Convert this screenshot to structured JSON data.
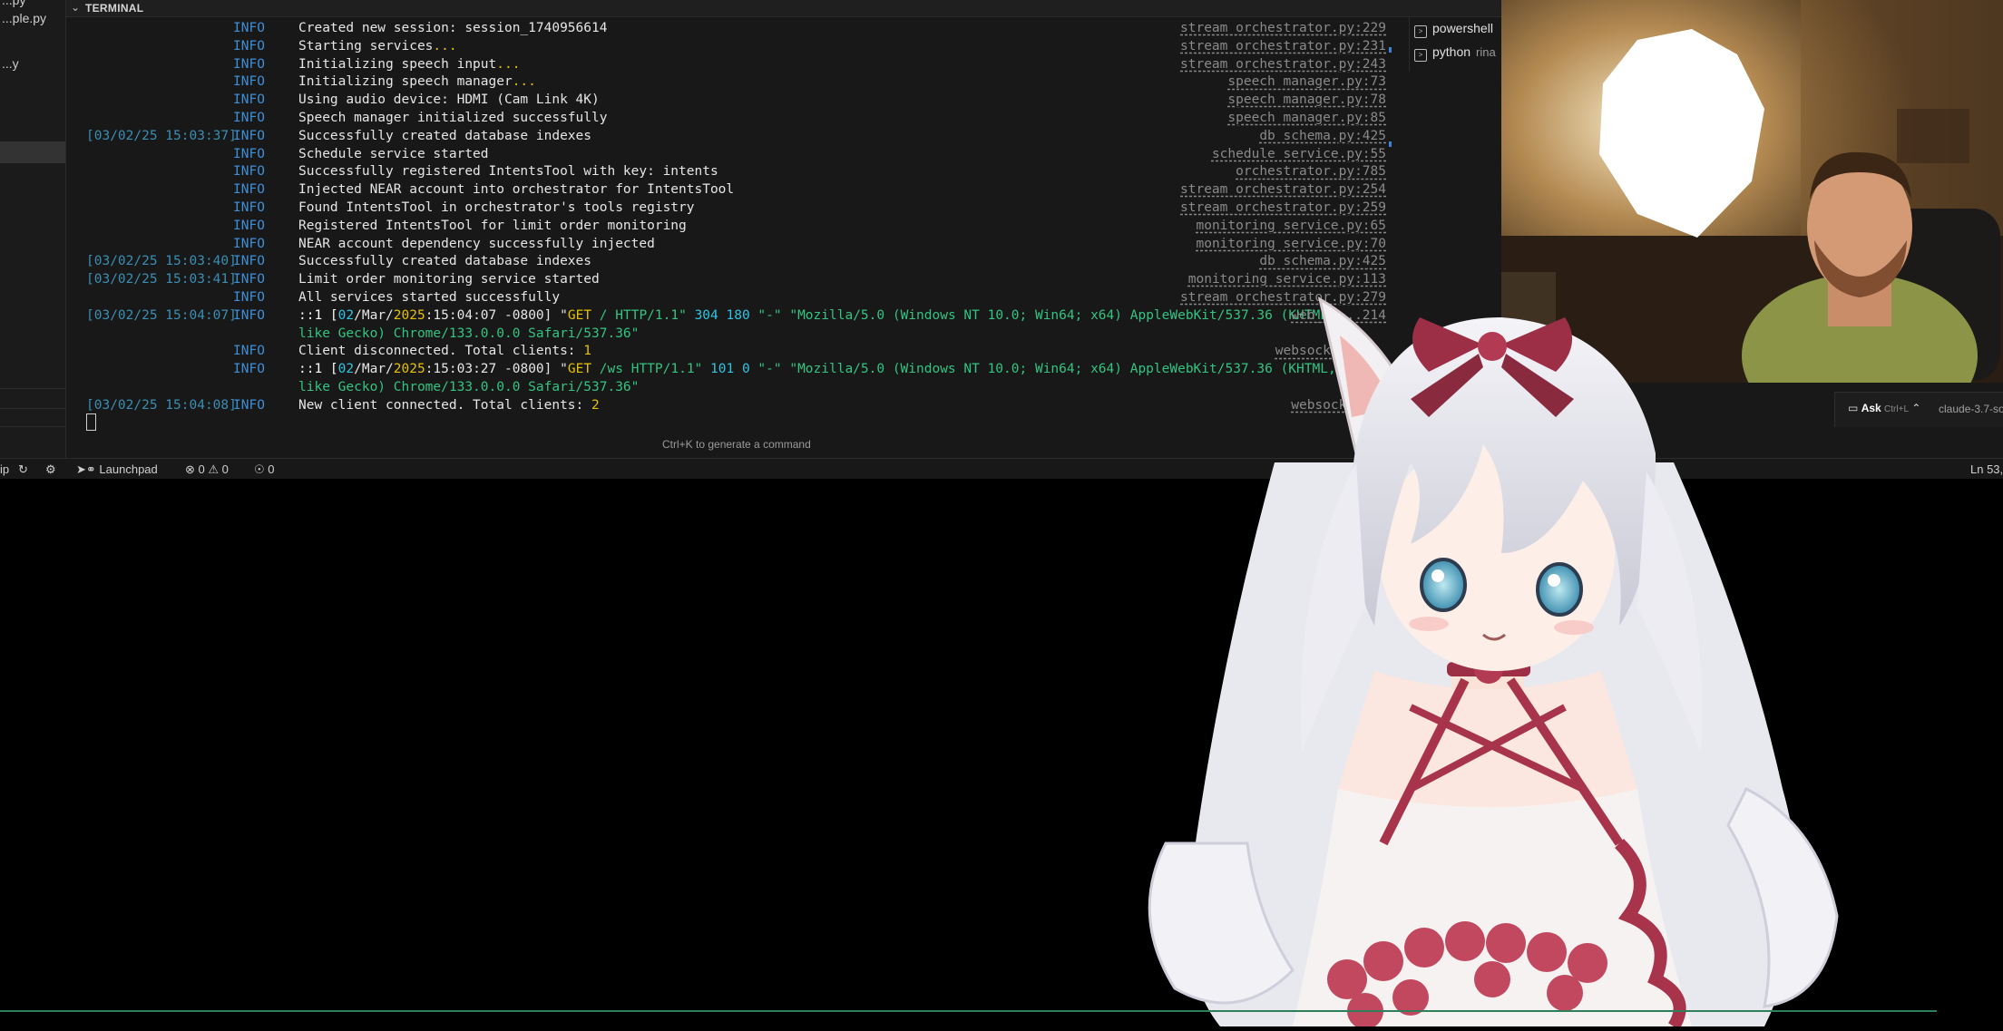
{
  "sidebar": {
    "files": [
      "...py",
      "...ple.py",
      "...y"
    ]
  },
  "terminal": {
    "header": "TERMINAL",
    "lines": [
      {
        "ts": "",
        "level": "INFO",
        "msg": "Created new session: session_1740956614",
        "src": "stream orchestrator.py:229"
      },
      {
        "ts": "",
        "level": "INFO",
        "msg_parts": [
          "Starting services",
          "..."
        ],
        "src": "stream orchestrator.py:231"
      },
      {
        "ts": "",
        "level": "INFO",
        "msg_parts": [
          "Initializing speech input",
          "..."
        ],
        "src": "stream orchestrator.py:243"
      },
      {
        "ts": "",
        "level": "INFO",
        "msg_parts": [
          "Initializing speech manager",
          "..."
        ],
        "src": "speech manager.py:73"
      },
      {
        "ts": "",
        "level": "INFO",
        "msg": "Using audio device: HDMI (Cam Link 4K)",
        "src": "speech manager.py:78"
      },
      {
        "ts": "",
        "level": "INFO",
        "msg": "Speech manager initialized successfully",
        "src": "speech manager.py:85"
      },
      {
        "ts": "[03/02/25 15:03:37]",
        "level": "INFO",
        "msg": "Successfully created database indexes",
        "src": "db schema.py:425"
      },
      {
        "ts": "",
        "level": "INFO",
        "msg": "Schedule service started",
        "src": "schedule service.py:55"
      },
      {
        "ts": "",
        "level": "INFO",
        "msg": "Successfully registered IntentsTool with key: intents",
        "src": "orchestrator.py:785"
      },
      {
        "ts": "",
        "level": "INFO",
        "msg": "Injected NEAR account into orchestrator for IntentsTool",
        "src": "stream orchestrator.py:254"
      },
      {
        "ts": "",
        "level": "INFO",
        "msg": "Found IntentsTool in orchestrator's tools registry",
        "src": "stream orchestrator.py:259"
      },
      {
        "ts": "",
        "level": "INFO",
        "msg": "Registered IntentsTool for limit order monitoring",
        "src": "monitoring service.py:65"
      },
      {
        "ts": "",
        "level": "INFO",
        "msg": "NEAR account dependency successfully injected",
        "src": "monitoring service.py:70"
      },
      {
        "ts": "[03/02/25 15:03:40]",
        "level": "INFO",
        "msg": "Successfully created database indexes",
        "src": "db schema.py:425"
      },
      {
        "ts": "[03/02/25 15:03:41]",
        "level": "INFO",
        "msg": "Limit order monitoring service started",
        "src": "monitoring service.py:113"
      },
      {
        "ts": "",
        "level": "INFO",
        "msg": "All services started successfully",
        "src": "stream orchestrator.py:279"
      }
    ],
    "http1": {
      "ts": "[03/02/25 15:04:07]",
      "level": "INFO",
      "prefix": "::1 [",
      "day": "02",
      "mid": "/Mar/",
      "year": "2025",
      "time": ":15:04:07 -0800",
      "close": "] \"",
      "method": "GET",
      "path": " / HTTP/1.1\" ",
      "status": "304",
      "size": "180",
      "tail": " \"-\" \"Mozilla/5.0 (Windows NT 10.0; Win64; x64) AppleWebKit/537.36 (KHTML,",
      "cont": "like Gecko) Chrome/133.0.0.0 Safari/537.36\"",
      "src": "web_lo...214"
    },
    "disc": {
      "level": "INFO",
      "msg": "Client disconnected. Total clients: ",
      "count": "1",
      "src": "websocket s..."
    },
    "http2": {
      "level": "INFO",
      "prefix": "::1 [",
      "day": "02",
      "mid": "/Mar/",
      "year": "2025",
      "time": ":15:03:27 -0800",
      "close": "] \"",
      "method": "GET",
      "path": " /ws HTTP/1.1\" ",
      "status": "101",
      "size": "0",
      "tail": " \"-\" \"Mozilla/5.0 (Windows NT 10.0; Win64; x64) AppleWebKit/537.36 (KHTML,",
      "cont": "like Gecko) Chrome/133.0.0.0 Safari/537.36\"",
      "src": "we..."
    },
    "conn": {
      "ts": "[03/02/25 15:04:08]",
      "level": "INFO",
      "msg": "New client connected. Total clients: ",
      "count": "2",
      "src": "websocket..."
    },
    "hint": "Ctrl+K to generate a command"
  },
  "terminal_tabs": [
    {
      "label": "powershell",
      "extra": ""
    },
    {
      "label": "python",
      "extra": "rina"
    }
  ],
  "chat": {
    "ask": "Ask",
    "shortcut": "Ctrl+L",
    "model": "claude-3.7-so"
  },
  "statusbar": {
    "left_trunc": "ip",
    "launchpad": "Launchpad",
    "errors": "0",
    "warnings": "0",
    "ports": "0",
    "position": "Ln 53,"
  },
  "colors": {
    "info": "#3f8fd7",
    "timestamp": "#3b8eb3",
    "accent_yellow": "#e5c100",
    "accent_cyan": "#2fc4e3",
    "accent_green": "#33c481"
  }
}
